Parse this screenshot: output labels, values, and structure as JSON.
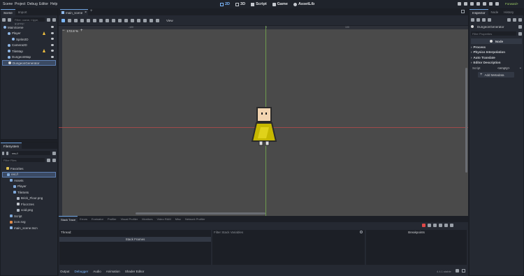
{
  "menubar": {
    "items": [
      "Scene",
      "Project",
      "Debug",
      "Editor",
      "Help"
    ],
    "screens": [
      "2D",
      "3D",
      "Script",
      "Game",
      "AssetLib"
    ],
    "active_screen": "2D",
    "renderer": "Forward+"
  },
  "scene_dock": {
    "tabs": [
      "Scene",
      "Import"
    ],
    "filter_placeholder": "Filter: name, t:type, g:group",
    "nodes": [
      {
        "name": "MainScene",
        "depth": 0,
        "icon": "node2d-icon",
        "warning": false
      },
      {
        "name": "Player",
        "depth": 1,
        "icon": "characterbody-icon",
        "warning": true
      },
      {
        "name": "Sprite2D",
        "depth": 2,
        "icon": "sprite-icon",
        "warning": false
      },
      {
        "name": "Camera2D",
        "depth": 1,
        "icon": "camera-icon",
        "warning": false
      },
      {
        "name": "TileMap",
        "depth": 1,
        "icon": "tilemap-icon",
        "warning": true
      },
      {
        "name": "DungeonMap",
        "depth": 1,
        "icon": "node2d-icon",
        "warning": false
      },
      {
        "name": "DungeonGenerator",
        "depth": 1,
        "icon": "node-icon",
        "warning": false,
        "selected": true
      }
    ]
  },
  "filesystem": {
    "tab": "FileSystem",
    "path": "res://",
    "filter_placeholder": "Filter Files",
    "items": [
      {
        "name": "Favorites",
        "depth": 0,
        "icon": "star-icon"
      },
      {
        "name": "res://",
        "depth": 0,
        "icon": "folder-icon",
        "selected": true
      },
      {
        "name": "Assets",
        "depth": 1,
        "icon": "folder-icon"
      },
      {
        "name": "Player",
        "depth": 2,
        "icon": "folder-icon"
      },
      {
        "name": "TileSets",
        "depth": 2,
        "icon": "folder-icon"
      },
      {
        "name": "Brick_Floor.png",
        "depth": 3,
        "icon": "image-icon"
      },
      {
        "name": "Floor.tres",
        "depth": 3,
        "icon": "resource-icon"
      },
      {
        "name": "void.png",
        "depth": 3,
        "icon": "image-icon"
      },
      {
        "name": "Script",
        "depth": 1,
        "icon": "folder-icon"
      },
      {
        "name": "icon.svg",
        "depth": 1,
        "icon": "svg-icon"
      },
      {
        "name": "main_scene.tscn",
        "depth": 1,
        "icon": "scene-icon"
      }
    ]
  },
  "editor_tabs": {
    "scene_tab": "main_scene"
  },
  "viewport": {
    "view_menu": "View",
    "zoom": "172.8 %",
    "ruler_labels": [
      "-100",
      "0",
      "100",
      "200",
      "300"
    ]
  },
  "inspector": {
    "tabs": [
      "Inspector",
      "Node",
      "History"
    ],
    "object": "DungeonGenerator",
    "filter_placeholder": "Filter Properties",
    "class_header": "Node",
    "sections": [
      "Process",
      "Physics Interpolation",
      "Auto Translate",
      "Editor Description"
    ],
    "script_label": "Script",
    "script_value": "<empty>",
    "add_metadata": "Add Metadata"
  },
  "bottom_panel": {
    "debugger_tabs": [
      "Stack Trace",
      "Errors",
      "Evaluator",
      "Profiler",
      "Visual Profiler",
      "Monitors",
      "Video RAM",
      "Misc",
      "Network Profiler"
    ],
    "thread_label": "Thread:",
    "stack_frames": "Stack Frames",
    "filter_vars_placeholder": "Filter Stack Variables",
    "breakpoints": "Breakpoints",
    "bottom_tabs": [
      "Output",
      "Debugger",
      "Audio",
      "Animation",
      "Shader Editor"
    ],
    "active_bottom_tab": "Debugger",
    "version": "4.4.1.stable"
  },
  "colors": {
    "accent": "#6fa3e0",
    "canvas": "#4a4a4a",
    "panel": "#252932",
    "axis_x": "#c34a4a",
    "axis_y": "#7fbf4f"
  }
}
